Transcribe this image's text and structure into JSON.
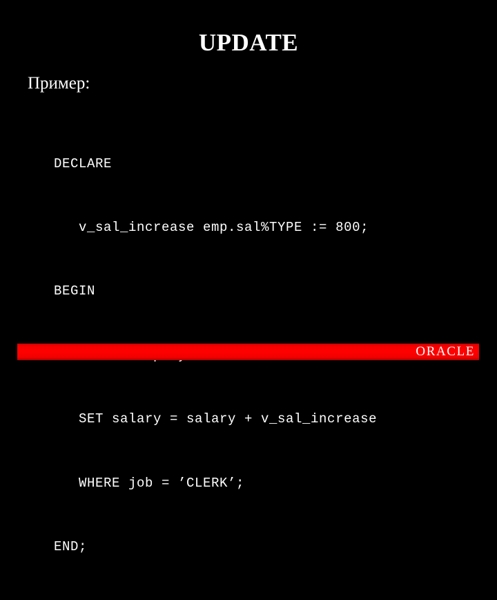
{
  "slide": {
    "title": "UPDATE",
    "subtitle": "Пример:",
    "background_color": "#000000",
    "text_color": "#ffffff",
    "code": {
      "lines": [
        "DECLARE",
        "   v_sal_increase emp.sal%TYPE := 800;",
        "BEGIN",
        "   UPDATE employee",
        "   SET salary = salary + v_sal_increase",
        "   WHERE job = ’CLERK’;",
        "END;"
      ]
    },
    "footer": {
      "logo_text": "ORACLE",
      "bar_color": "#ff0000",
      "logo_color": "#ffffff"
    }
  }
}
